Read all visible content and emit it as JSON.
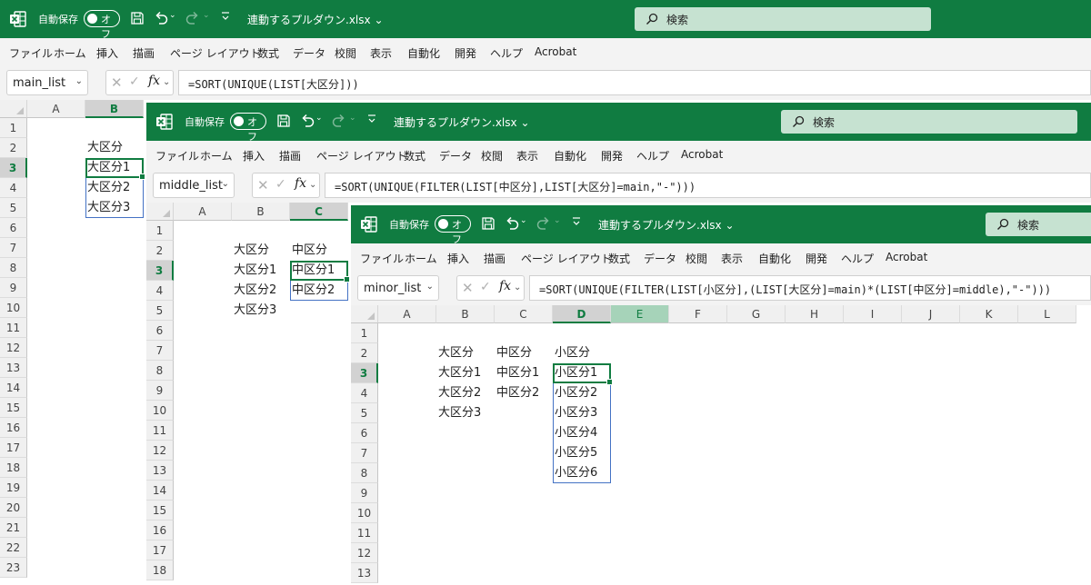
{
  "app": {
    "autosave_label": "自動保存",
    "autosave_state": "オフ",
    "file_title": "連動するプルダウン.xlsx",
    "search_placeholder": "検索",
    "title_dropdown": "⌄",
    "qa_dropdown": "⌄",
    "accent_color": "#107c41"
  },
  "menu": [
    "ファイル",
    "ホーム",
    "挿入",
    "描画",
    "ページ レイアウト",
    "数式",
    "データ",
    "校閲",
    "表示",
    "自動化",
    "開発",
    "ヘルプ",
    "Acrobat"
  ],
  "icons": {
    "app": "excel-icon",
    "save": "save-icon",
    "undo": "undo-icon",
    "redo": "redo-icon",
    "search": "search-icon"
  },
  "windows": [
    {
      "name_box": "main_list",
      "formula": "=SORT(UNIQUE(LIST[大区分]))",
      "columns": [
        "A",
        "B"
      ],
      "selected_column": "B",
      "rows": [
        "1",
        "2",
        "3",
        "4",
        "5",
        "6",
        "7",
        "8",
        "9",
        "10",
        "11",
        "12",
        "13",
        "14",
        "15",
        "16",
        "17",
        "18",
        "19",
        "20",
        "21",
        "22",
        "23"
      ],
      "selected_row": "3",
      "cells": {
        "B2": "大区分",
        "B3": "大区分1",
        "B4": "大区分2",
        "B5": "大区分3"
      }
    },
    {
      "name_box": "middle_list",
      "formula": "=SORT(UNIQUE(FILTER(LIST[中区分],LIST[大区分]=main,\"-\")))",
      "columns": [
        "A",
        "B",
        "C"
      ],
      "selected_column": "C",
      "rows": [
        "1",
        "2",
        "3",
        "4",
        "5",
        "6",
        "7",
        "8",
        "9",
        "10",
        "11",
        "12",
        "13",
        "14",
        "15",
        "16",
        "17",
        "18"
      ],
      "selected_row": "3",
      "cells": {
        "B2": "大区分",
        "C2": "中区分",
        "B3": "大区分1",
        "C3": "中区分1",
        "B4": "大区分2",
        "C4": "中区分2",
        "B5": "大区分3"
      }
    },
    {
      "name_box": "minor_list",
      "formula": "=SORT(UNIQUE(FILTER(LIST[小区分],(LIST[大区分]=main)*(LIST[中区分]=middle),\"-\")))",
      "columns": [
        "A",
        "B",
        "C",
        "D",
        "E",
        "F",
        "G",
        "H",
        "I",
        "J",
        "K",
        "L"
      ],
      "selected_column": "D",
      "rows": [
        "1",
        "2",
        "3",
        "4",
        "5",
        "6",
        "7",
        "8",
        "9",
        "10",
        "11",
        "12",
        "13"
      ],
      "selected_row": "3",
      "cells": {
        "B2": "大区分",
        "C2": "中区分",
        "D2": "小区分",
        "B3": "大区分1",
        "C3": "中区分1",
        "D3": "小区分1",
        "B4": "大区分2",
        "C4": "中区分2",
        "D4": "小区分2",
        "B5": "大区分3",
        "D5": "小区分3",
        "D6": "小区分4",
        "D7": "小区分5",
        "D8": "小区分6"
      }
    }
  ]
}
